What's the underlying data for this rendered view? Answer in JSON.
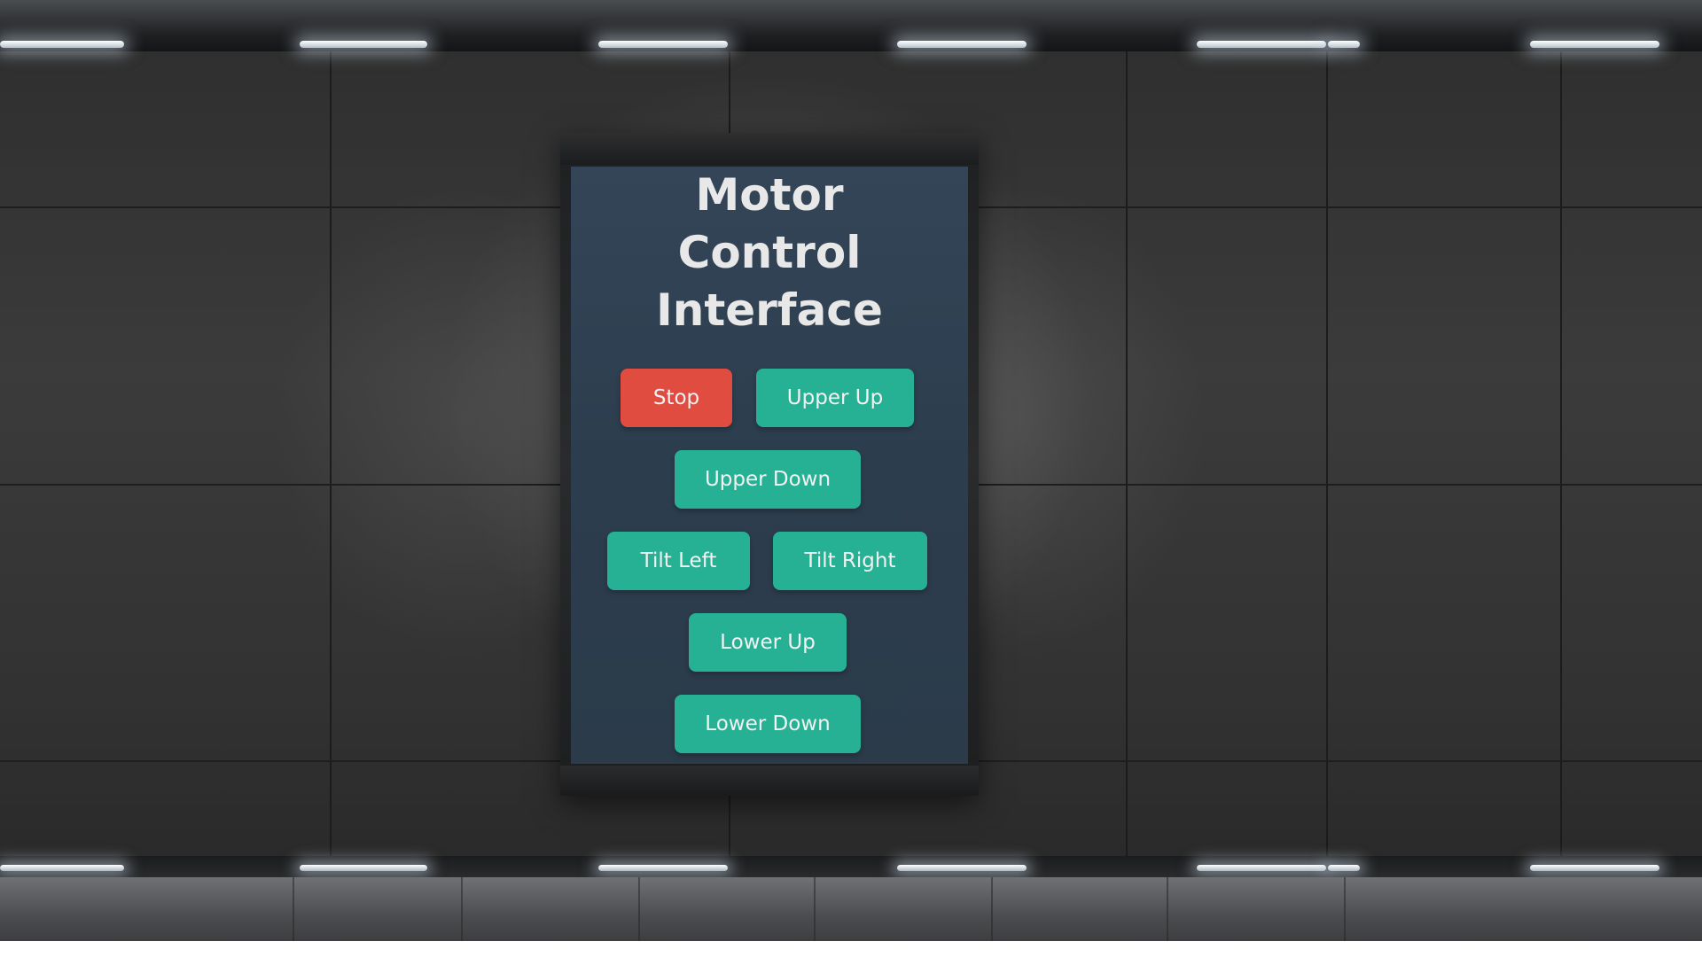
{
  "panel": {
    "title_lines": [
      "Motor",
      "Control",
      "Interface"
    ]
  },
  "buttons": {
    "stop": "Stop",
    "upper_up": "Upper Up",
    "upper_down": "Upper Down",
    "tilt_left": "Tilt Left",
    "tilt_right": "Tilt Right",
    "lower_up": "Lower Up",
    "lower_down": "Lower Down"
  },
  "colors": {
    "stop": "#e04c3f",
    "action": "#27b194",
    "screen": "#2c3d4e",
    "title": "#e8e8e8"
  }
}
